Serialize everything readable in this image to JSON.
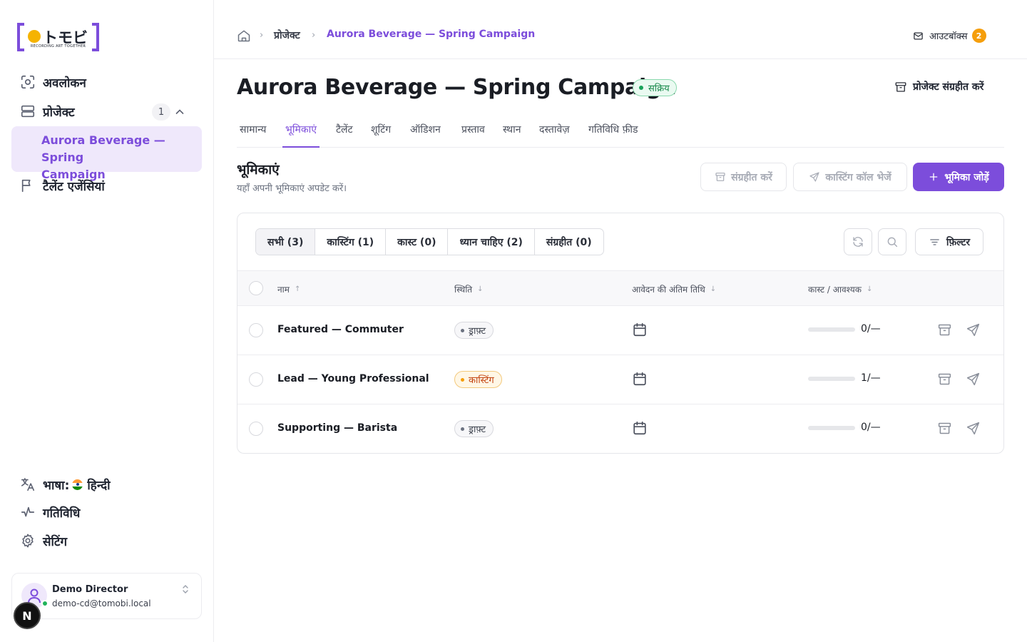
{
  "brand": {
    "logo_text": "トモビ",
    "tagline": "RECORDING ART TOGETHER",
    "accent": "#7c4ddb",
    "dot_color": "#f5b301"
  },
  "sidebar": {
    "overview": "अवलोकन",
    "projects": "प्रोजेक्ट",
    "projects_count": "1",
    "active_project_line1": "Aurora Beverage — Spring",
    "active_project_line2": "Campaign",
    "agencies": "टैलेंट एजेंसियां",
    "language_label": "भाषा:",
    "language_value": "हिन्दी",
    "activity": "गतिविधि",
    "settings": "सेटिंग"
  },
  "user": {
    "name": "Demo Director",
    "email": "demo-cd@tomobi.local",
    "badge": "N"
  },
  "breadcrumb": {
    "projects": "प्रोजेक्ट",
    "current": "Aurora Beverage — Spring Campaign"
  },
  "outbox": {
    "label": "आउटबॉक्स",
    "count": "2"
  },
  "page": {
    "title": "Aurora Beverage — Spring Campaign",
    "status": "सक्रिय",
    "archive_project": "प्रोजेक्ट संग्रहीत करें"
  },
  "tabs": [
    "सामान्य",
    "भूमिकाएं",
    "टैलेंट",
    "शूटिंग",
    "ऑडिशन",
    "प्रस्ताव",
    "स्थान",
    "दस्तावेज़",
    "गतिविधि फ़ीड"
  ],
  "roles_section": {
    "title": "भूमिकाएं",
    "subtitle": "यहाँ अपनी भूमिकाएं अपडेट करें।",
    "archive_btn": "संग्रहीत करें",
    "send_call_btn": "कास्टिंग कॉल भेजें",
    "add_role_btn": "भूमिका जोड़ें"
  },
  "filter_tabs": [
    "सभी (3)",
    "कास्टिंग (1)",
    "कास्ट (0)",
    "ध्यान चाहिए (2)",
    "संग्रहीत (0)"
  ],
  "filter_label": "फ़िल्टर",
  "table": {
    "headers": {
      "name": "नाम",
      "status": "स्थिति",
      "deadline": "आवेदन की अंतिम तिथि",
      "cast": "कास्ट / आवश्यक"
    },
    "rows": [
      {
        "name": "Featured — Commuter",
        "status": "ड्राफ़्ट",
        "status_type": "draft",
        "progress": 0,
        "cast_text": "0/—"
      },
      {
        "name": "Lead — Young Professional",
        "status": "कास्टिंग",
        "status_type": "casting",
        "progress": 0,
        "cast_text": "1/—"
      },
      {
        "name": "Supporting — Barista",
        "status": "ड्राफ़्ट",
        "status_type": "draft",
        "progress": 0,
        "cast_text": "0/—"
      }
    ]
  }
}
